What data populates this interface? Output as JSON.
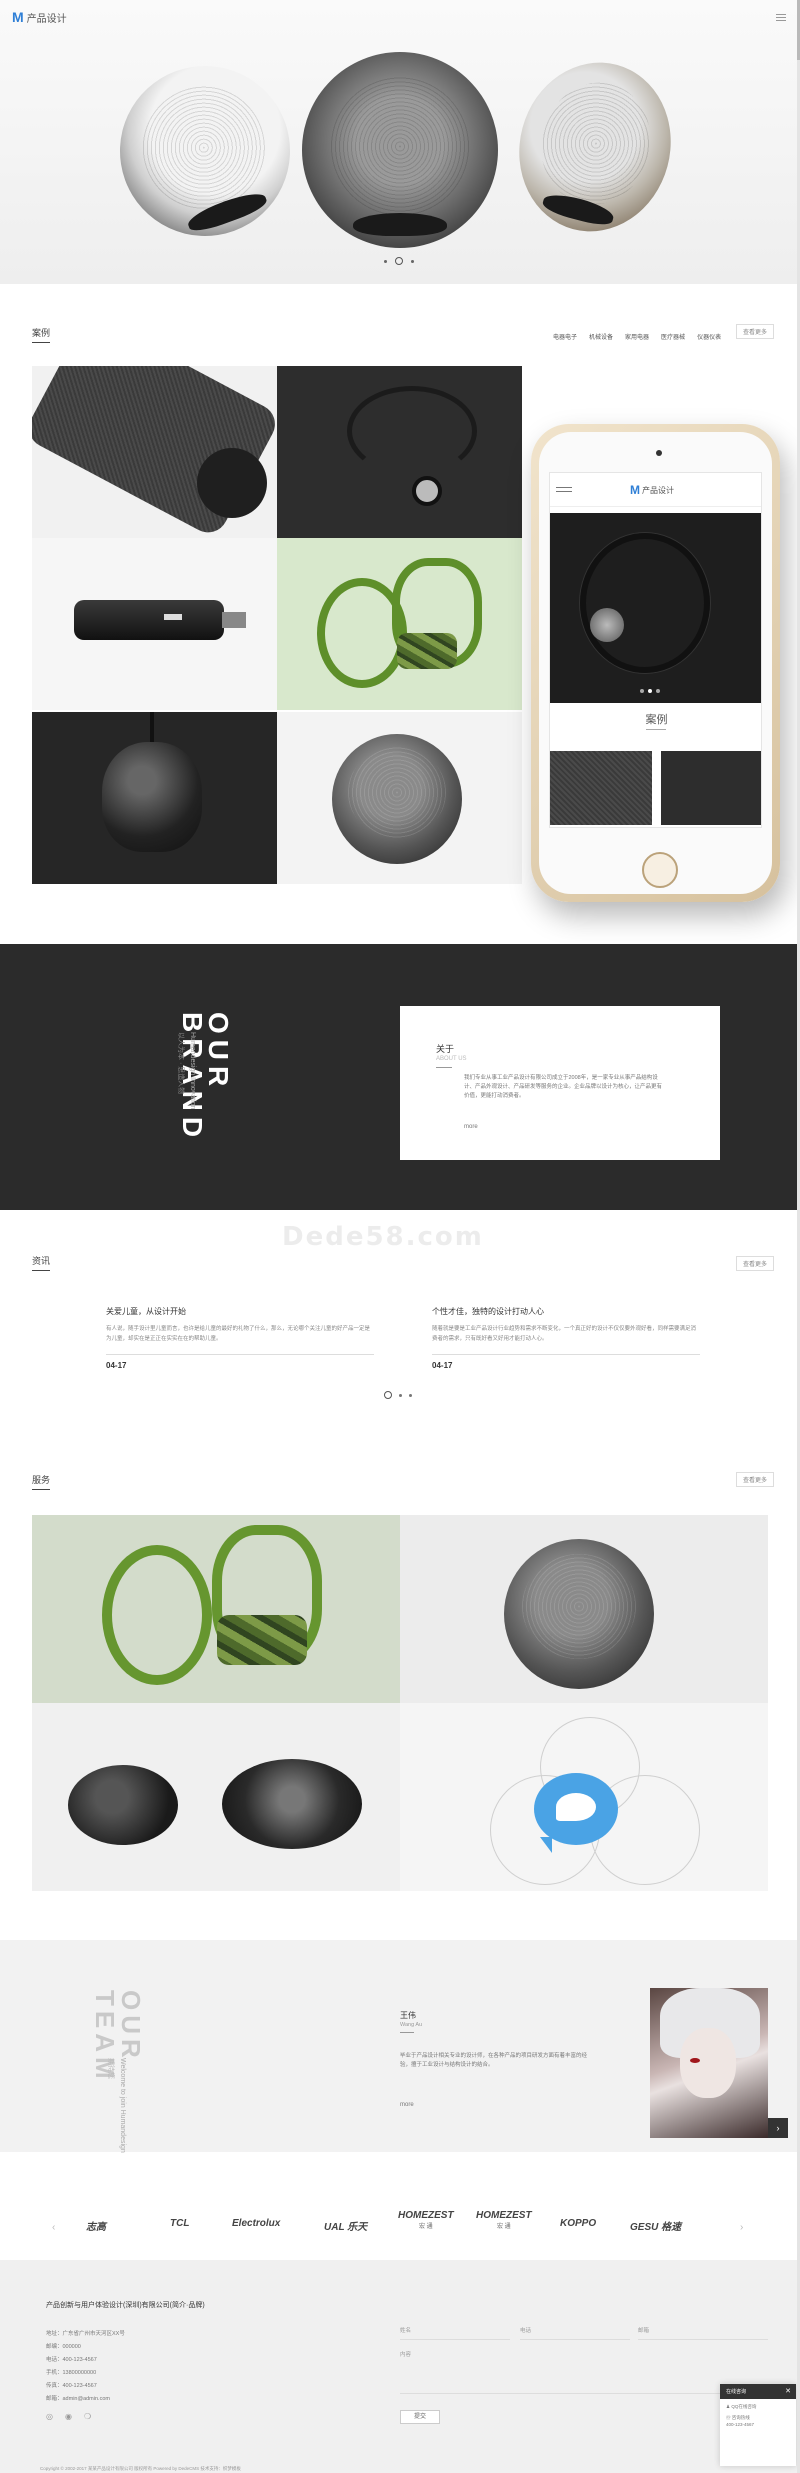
{
  "header": {
    "logo_mark": "M",
    "logo_text": "产品设计"
  },
  "cases": {
    "title": "案例",
    "more": "查看更多",
    "tabs": [
      "电器电子",
      "机械设备",
      "家用电器",
      "医疗器械",
      "仪器仪表"
    ]
  },
  "phone": {
    "logo_mark": "M",
    "logo_text": "产品设计",
    "case_label": "案例"
  },
  "brand": {
    "word1": "OUR",
    "word2": "BRAND",
    "sub_en": "Humandesign Innovation",
    "sub_cn": "以人为本 · 思造人物",
    "about_title": "关于",
    "about_sub": "ABOUT US",
    "about_text": "我们专业从事工业产品设计有限公司成立于2008年，是一家专业从事产品结构设计、产品外观设计、产品研发等服务的企业。企业品牌以设计为核心，让产品更有价值，更能打动消费者。",
    "about_more": "more"
  },
  "watermark": "Dede58.com",
  "news": {
    "title": "资讯",
    "more": "查看更多",
    "items": [
      {
        "title": "关爱儿童，从设计开始",
        "desc": "有人说，随手设计里儿童而言，也许是给儿童的最好的礼物了什么，那么，无论哪个关注儿童的好产品一定是为儿童，却实在是正正在实实在在的帮助儿童。",
        "date": "04-17"
      },
      {
        "title": "个性才佳，独特的设计打动人心",
        "desc": "随着就是要是工业产品设计行业趋势和需求不断变化，一个真正好的设计不仅仅要外观好看，同样需要满足消费者的需求，只有既好看又好用才能打动人心。",
        "date": "04-17"
      }
    ]
  },
  "services": {
    "title": "服务",
    "more": "查看更多"
  },
  "team": {
    "word1": "OUR",
    "word2": "TEAM",
    "sub_en": "Welcome to join Humandesign",
    "sub_cn": "期待您",
    "member_name": "王伟",
    "member_en": "Wang Au",
    "member_desc": "毕业于产品设计相关专业的设计师，在各种产品的项目研发方面有着丰富的经验，擅于工业设计与结构设计的结合。",
    "member_more": "more",
    "next_icon": "›"
  },
  "partners": {
    "prev": "‹",
    "next": "›",
    "logos": [
      {
        "name": "志高",
        "sub": ""
      },
      {
        "name": "TCL",
        "sub": ""
      },
      {
        "name": "Electrolux",
        "sub": ""
      },
      {
        "name": "UAL 乐天",
        "sub": ""
      },
      {
        "name": "HOMEZEST",
        "sub": "宏 通"
      },
      {
        "name": "HOMEZEST",
        "sub": "宏 通"
      },
      {
        "name": "KOPPO",
        "sub": ""
      },
      {
        "name": "GESU 格速",
        "sub": ""
      }
    ]
  },
  "footer": {
    "company": "产品创新与用户体验设计(深圳)有限公司(简介·品牌)",
    "lines": [
      "地址：广东省广州市天河区XX号",
      "邮编：000000",
      "电话：400-123-4567",
      "手机：13800000000",
      "传真：400-123-4567",
      "邮箱：admin@admin.com"
    ],
    "form": {
      "name": "姓名",
      "phone": "电话",
      "email": "邮箱",
      "message": "内容",
      "submit": "提交"
    },
    "copyright": "Copyright © 2002-2017 某某产品设计有限公司 版权所有   Powered by DedeCMS          技术支持：织梦模板"
  },
  "float": {
    "title": "在线咨询",
    "qq": "QQ在线咨询",
    "phone_label": "咨询热线",
    "phone": "400-123-4567"
  }
}
